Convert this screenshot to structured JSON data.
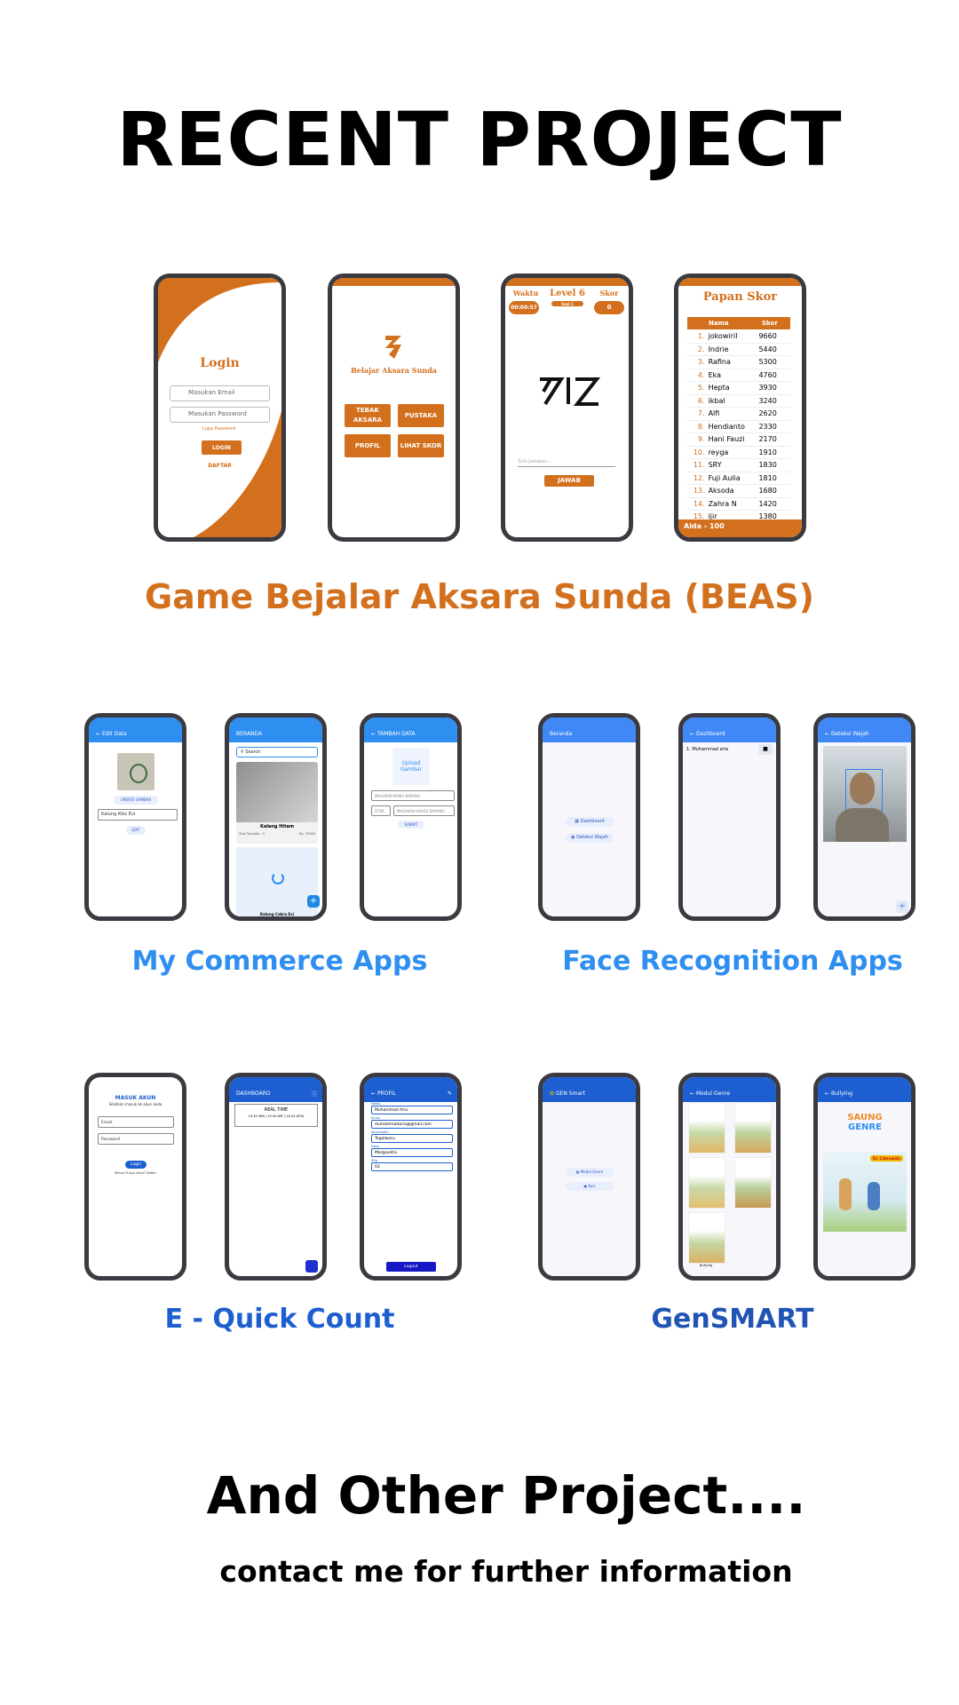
{
  "page": {
    "title": "RECENT PROJECT",
    "footer_title": "And Other Project....",
    "footer_subtitle": "contact me for further information"
  },
  "colors": {
    "beas": "#d3701e",
    "commerce": "#2f8ff0",
    "face": "#2f8ff0",
    "quickcount": "#1d5fd1",
    "gensmart": "#2155b5"
  },
  "projects": {
    "beas": {
      "caption": "Game Bejalar Aksara Sunda (BEAS)",
      "login": {
        "title": "Login",
        "email_placeholder": "Masukan Email",
        "password_placeholder": "Masukan Password",
        "forgot": "Lupa Password",
        "login_button": "LOGIN",
        "register_link": "DAFTAR"
      },
      "home": {
        "app_name": "Belajar Aksara Sunda",
        "buttons": [
          "TEBAK AKSARA",
          "PUSTAKA",
          "PROFIL",
          "LIHAT SKOR"
        ]
      },
      "game": {
        "waktu_label": "Waktu",
        "waktu_value": "00:00:57",
        "level": "Level 6",
        "soal": "Soal 1",
        "skor_label": "Skor",
        "skor_value": "0",
        "input_placeholder": "Tulis Jawaban...",
        "answer_button": "JAWAB"
      },
      "scoreboard": {
        "title": "Papan Skor",
        "col_name": "Nama",
        "col_score": "Skor",
        "rows": [
          {
            "no": "1.",
            "name": "jokowiril",
            "score": "9660"
          },
          {
            "no": "2.",
            "name": "Indrie",
            "score": "5440"
          },
          {
            "no": "3.",
            "name": "Rafina",
            "score": "5300"
          },
          {
            "no": "4.",
            "name": "Eka",
            "score": "4760"
          },
          {
            "no": "5.",
            "name": "Hepta",
            "score": "3930"
          },
          {
            "no": "6.",
            "name": "ikbal",
            "score": "3240"
          },
          {
            "no": "7.",
            "name": "Alfi",
            "score": "2620"
          },
          {
            "no": "8.",
            "name": "Hendianto",
            "score": "2330"
          },
          {
            "no": "9.",
            "name": "Hani Fauzi",
            "score": "2170"
          },
          {
            "no": "10.",
            "name": "reyga",
            "score": "1910"
          },
          {
            "no": "11.",
            "name": "SRY",
            "score": "1830"
          },
          {
            "no": "12.",
            "name": "Fuji Aulia",
            "score": "1810"
          },
          {
            "no": "13.",
            "name": "Aksoda",
            "score": "1680"
          },
          {
            "no": "14.",
            "name": "Zahra N",
            "score": "1420"
          },
          {
            "no": "15.",
            "name": "ijir",
            "score": "1380"
          }
        ],
        "footer": "Alda - 100"
      }
    },
    "commerce": {
      "caption": "My Commerce Apps",
      "edit": {
        "appbar": "Edit Data",
        "update_button": "UPDATE GAMBAR",
        "name_value": "Kalung Kiko Evi",
        "edit_button": "EDIT"
      },
      "home": {
        "appbar": "BERANDA",
        "search_placeholder": "Search",
        "item_title": "Kalang Hitam",
        "item_stock": "Stok Tersedia : 5",
        "item_price": "Rp. 70000",
        "item_bottom": "Kalung Cakra Evi"
      },
      "add": {
        "appbar": "TAMBAH DATA",
        "upload": "Upload Gambar",
        "name_placeholder": "MASUKAN NAMA BARANG",
        "stock_placeholder": "STOK",
        "price_placeholder": "MASUKAN HARGA BARANG",
        "submit": "SUBMIT"
      }
    },
    "face": {
      "caption": "Face Recognition Apps",
      "home": {
        "appbar": "Beranda",
        "btn1": "Dashboard",
        "btn2": "Deteksi Wajah"
      },
      "dashboard": {
        "appbar": "Dashboard",
        "row": "1. Muhammad aria"
      },
      "detect": {
        "appbar": "Deteksi Wajah"
      }
    },
    "quickcount": {
      "caption": "E - Quick Count",
      "login": {
        "title": "MASUK AKUN",
        "subtitle": "Silahkan masuk ke akun anda",
        "email": "Email",
        "password": "Password",
        "button": "Login",
        "register": "Belum Punya Akun? Daftar"
      },
      "dashboard": {
        "appbar": "DASHBOARD",
        "realtime_title": "REAL TIME",
        "realtime_values": "19.44 WIB | 19.44 WIT | 20.44 WITA"
      },
      "profile": {
        "appbar": "PROFIL",
        "labels": [
          "Nama",
          "Email",
          "Kecamatan",
          "Desa",
          "Rt/g"
        ],
        "values": [
          "Muhammad Aria",
          "muhammadaria@gmail.com",
          "Tegalwaru",
          "Margasetia",
          "03"
        ],
        "logout": "Logout"
      }
    },
    "gensmart": {
      "caption": "GenSMART",
      "home": {
        "appbar": "GEN Smart",
        "btn1": "Modul Genre",
        "btn2": "Kuis"
      },
      "modul": {
        "appbar": "Modul Genre",
        "last_caption": "Bullying"
      },
      "bullying": {
        "appbar": "Bullying",
        "logo_top": "SAUNG",
        "logo_bottom": "GENRE",
        "badge": "Dr. Cakrawala"
      }
    }
  }
}
